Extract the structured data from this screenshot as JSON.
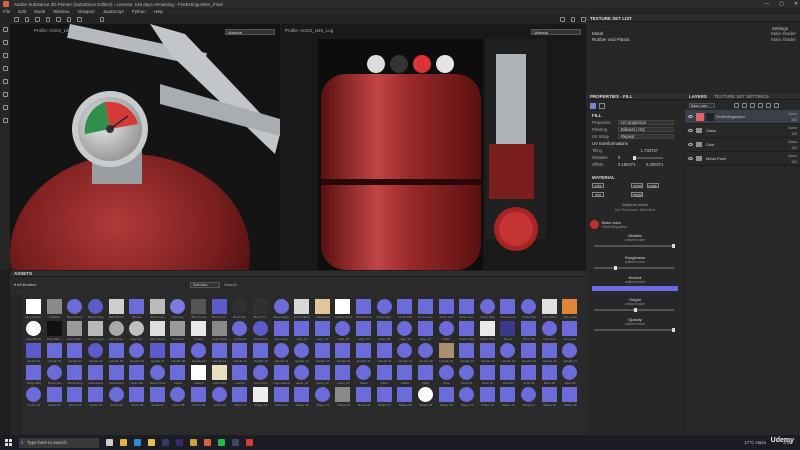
{
  "window": {
    "title": "Adobe Substance 3D Painter (Substance Edition) - License: 146 days remaining - FireExtinguisher_Final",
    "min": "—",
    "max": "▢",
    "close": "✕"
  },
  "menu": [
    "File",
    "Edit",
    "Mode",
    "Window",
    "Viewport",
    "JavaScript",
    "Python",
    "Help"
  ],
  "viewport3d": {
    "label": "Profile: ACES_LBS_Lug",
    "mode": "Material"
  },
  "viewport2d": {
    "label": "Profile: ACES_LBS_Lug",
    "mode": "Material"
  },
  "texture_set_list": {
    "title": "TEXTURE SET LIST",
    "settings": "Settings",
    "items": [
      {
        "name": "Metal",
        "shader": "Main shader"
      },
      {
        "name": "Rubber and Plastic",
        "shader": "Main shader"
      }
    ]
  },
  "properties": {
    "title": "PROPERTIES - FILL",
    "section_fill": "FILL",
    "projection_label": "Projection",
    "projection": "UV projection",
    "filtering_label": "Filtering",
    "filtering": "Bilinear | HQ",
    "uv_wrap_label": "UV Wrap",
    "uv_wrap": "Repeat",
    "uv_transform": "UV transformations",
    "tiling_label": "Tiling",
    "tiling_value": "1.733747",
    "rotation_label": "Rotation",
    "rotation_value": "0",
    "offset_label": "Offset",
    "offset_x": "0.180371",
    "offset_y": "0.260371",
    "material_section": "MATERIAL",
    "channels": [
      "color",
      "metal",
      "rough",
      "nrm",
      "height"
    ],
    "material_mode": "Material mode",
    "no_resource": "No Resource Selected",
    "base_color": "Base color",
    "base_color_sub": "FireExtinguisher",
    "metallic": "Metallic",
    "uniform": "uniform color",
    "roughness": "Roughness",
    "normal": "Normal",
    "height": "Height",
    "opacity": "Opacity"
  },
  "layers": {
    "tab1": "LAYERS",
    "tab2": "TEXTURE SET SETTINGS",
    "blend": "Base color",
    "items": [
      {
        "name": "FireExtinguisher",
        "blend": "Norm",
        "opacity": "100"
      },
      {
        "name": "Glass",
        "blend": "Norm",
        "opacity": "100"
      },
      {
        "name": "Dust",
        "blend": "Norm",
        "opacity": "100"
      },
      {
        "name": "Metal Paint",
        "blend": "Norm",
        "opacity": "100"
      }
    ]
  },
  "assets": {
    "title": "ASSETS",
    "all_libraries": "All libraries",
    "filter": "Selection",
    "search_placeholder": "Search",
    "tiles": [
      {
        "label": "Alloy Comm..",
        "color": "#ffffff"
      },
      {
        "label": "Artifacts",
        "color": "#8a8a8a"
      },
      {
        "label": "Bevel Rect..",
        "color": "#6b6bd9"
      },
      {
        "label": "Bevel Cape",
        "color": "#5c5cc8"
      },
      {
        "label": "Blob Brush",
        "color": "#cfcfcf"
      },
      {
        "label": "Bnoise",
        "color": "#6b6bd9"
      },
      {
        "label": "Bolt Cross",
        "color": "#bbbbbb"
      },
      {
        "label": "Bolt Hex",
        "color": "#7a7ae0"
      },
      {
        "label": "Brush Line",
        "color": "#555555"
      },
      {
        "label": "Bevel Circ..",
        "color": "#5c5cc8"
      },
      {
        "label": "Bevel Sq..",
        "color": "#303030"
      },
      {
        "label": "Bevel Tri..",
        "color": "#303030"
      },
      {
        "label": "Bevel Edge",
        "color": "#6b6bd9"
      },
      {
        "label": "Cloth Fabric",
        "color": "#d8d8d8"
      },
      {
        "label": "Cardboard",
        "color": "#e0c69a"
      },
      {
        "label": "Carbon Dust",
        "color": "#ffffff"
      },
      {
        "label": "Circle Bump",
        "color": "#6b6bd9"
      },
      {
        "label": "Circle Dam..",
        "color": "#6b6bd9"
      },
      {
        "label": "Circle Bolt",
        "color": "#6b6bd9"
      },
      {
        "label": "Circle Cent..",
        "color": "#6b6bd9"
      },
      {
        "label": "Circle Grid",
        "color": "#6b6bd9"
      },
      {
        "label": "Circle Hex..",
        "color": "#6b6bd9"
      },
      {
        "label": "Circle Hole",
        "color": "#6b6bd9"
      },
      {
        "label": "Circle Lines",
        "color": "#6b6bd9"
      },
      {
        "label": "Circle Pad",
        "color": "#6b6bd9"
      },
      {
        "label": "Clay Blend",
        "color": "#e0e0e0"
      },
      {
        "label": "Clay Grain",
        "color": "#e0853a"
      },
      {
        "label": "Clay Brush",
        "color": "#ffffff"
      },
      {
        "label": "Clay Blen..",
        "color": "#111111"
      },
      {
        "label": "Clay Stam..",
        "color": "#9a9a9a"
      },
      {
        "label": "Clay Rough",
        "color": "#b8b8b8"
      },
      {
        "label": "Clay Scrat..",
        "color": "#a8a8a8"
      },
      {
        "label": "Clay Spl..",
        "color": "#c0c0c0"
      },
      {
        "label": "Clay Stroke",
        "color": "#dedede"
      },
      {
        "label": "Concrete",
        "color": "#9a9a9a"
      },
      {
        "label": "Craters",
        "color": "#e8e8e8"
      },
      {
        "label": "Cube Mask",
        "color": "#8a8a8a"
      },
      {
        "label": "Cyl Bevel",
        "color": "#6b6bd9"
      },
      {
        "label": "Dirt Brush",
        "color": "#5c5cc8"
      },
      {
        "label": "Dot Large",
        "color": "#6b6bd9"
      },
      {
        "label": "edge_01",
        "color": "#6b6bd9"
      },
      {
        "label": "edge_02",
        "color": "#6b6bd9"
      },
      {
        "label": "edge_03",
        "color": "#6b6bd9"
      },
      {
        "label": "edge_04",
        "color": "#6b6bd9"
      },
      {
        "label": "edge_05",
        "color": "#6b6bd9"
      },
      {
        "label": "edge_06",
        "color": "#6b6bd9"
      },
      {
        "label": "edge_07",
        "color": "#6b6bd9"
      },
      {
        "label": "Fabric",
        "color": "#6b6bd9"
      },
      {
        "label": "Fabric Blue",
        "color": "#6b6bd9"
      },
      {
        "label": "Fabric Soft",
        "color": "#eaeaea"
      },
      {
        "label": "Fleece",
        "color": "#3a3a8a"
      },
      {
        "label": "Floor Tile",
        "color": "#6b6bd9"
      },
      {
        "label": "Fine Grid",
        "color": "#6b6bd9"
      },
      {
        "label": "Fine Dots",
        "color": "#6b6bd9"
      },
      {
        "label": "Handle 01",
        "color": "#5c5cc8"
      },
      {
        "label": "Handle 02",
        "color": "#6b6bd9"
      },
      {
        "label": "Handle 03",
        "color": "#6b6bd9"
      },
      {
        "label": "Handle 04",
        "color": "#5c5cc8"
      },
      {
        "label": "Handle 05",
        "color": "#6b6bd9"
      },
      {
        "label": "Handle 06",
        "color": "#6b6bd9"
      },
      {
        "label": "Handle 07",
        "color": "#5c5cc8"
      },
      {
        "label": "Handle 08",
        "color": "#6b6bd9"
      },
      {
        "label": "Handle 09",
        "color": "#6b6bd9"
      },
      {
        "label": "Handle 10",
        "color": "#6b6bd9"
      },
      {
        "label": "Handle 11",
        "color": "#6b6bd9"
      },
      {
        "label": "Handle 12",
        "color": "#6b6bd9"
      },
      {
        "label": "Handle 13",
        "color": "#6b6bd9"
      },
      {
        "label": "Handle 14",
        "color": "#6b6bd9"
      },
      {
        "label": "Handle 15",
        "color": "#6b6bd9"
      },
      {
        "label": "Handle 16",
        "color": "#6b6bd9"
      },
      {
        "label": "Handle 17",
        "color": "#6b6bd9"
      },
      {
        "label": "Handle 18",
        "color": "#6b6bd9"
      },
      {
        "label": "Handle 19",
        "color": "#6b6bd9"
      },
      {
        "label": "Handle 20",
        "color": "#6b6bd9"
      },
      {
        "label": "Handle 21",
        "color": "#a89070"
      },
      {
        "label": "Handle 22",
        "color": "#6b6bd9"
      },
      {
        "label": "Handle 23",
        "color": "#6b6bd9"
      },
      {
        "label": "Handle 24",
        "color": "#6b6bd9"
      },
      {
        "label": "Handle 25",
        "color": "#6b6bd9"
      },
      {
        "label": "Handle 26",
        "color": "#6b6bd9"
      },
      {
        "label": "Handle 27",
        "color": "#6b6bd9"
      },
      {
        "label": "Hinge Bolt",
        "color": "#6b6bd9"
      },
      {
        "label": "Hinge Nut",
        "color": "#6b6bd9"
      },
      {
        "label": "Hinge Ring",
        "color": "#6b6bd9"
      },
      {
        "label": "Hole Bevel",
        "color": "#6b6bd9"
      },
      {
        "label": "Hole Deep",
        "color": "#6b6bd9"
      },
      {
        "label": "Hole Flat",
        "color": "#6b6bd9"
      },
      {
        "label": "Honey Dots",
        "color": "#6b6bd9"
      },
      {
        "label": "Insets",
        "color": "#6b6bd9"
      },
      {
        "label": "Label 1",
        "color": "#ffffff"
      },
      {
        "label": "Label Text",
        "color": "#e8e0c0"
      },
      {
        "label": "Leather",
        "color": "#6b6bd9"
      },
      {
        "label": "Logo Rect",
        "color": "#6b6bd9"
      },
      {
        "label": "Logo Round",
        "color": "#6b6bd9"
      },
      {
        "label": "panel_01",
        "color": "#6b6bd9"
      },
      {
        "label": "panel_02",
        "color": "#6b6bd9"
      },
      {
        "label": "panel_03",
        "color": "#6b6bd9"
      },
      {
        "label": "Paper",
        "color": "#6b6bd9"
      },
      {
        "label": "Patch",
        "color": "#6b6bd9"
      },
      {
        "label": "Plastic",
        "color": "#6b6bd9"
      },
      {
        "label": "Plate",
        "color": "#6b6bd9"
      },
      {
        "label": "Pipe",
        "color": "#6b6bd9"
      },
      {
        "label": "Rivet 01",
        "color": "#6b6bd9"
      },
      {
        "label": "Rivet 02",
        "color": "#6b6bd9"
      },
      {
        "label": "Rivet 03",
        "color": "#6b6bd9"
      },
      {
        "label": "Rivet 04",
        "color": "#6b6bd9"
      },
      {
        "label": "Rivet 05",
        "color": "#6b6bd9"
      },
      {
        "label": "Rivet 06",
        "color": "#6b6bd9"
      },
      {
        "label": "Screw 01",
        "color": "#6b6bd9"
      },
      {
        "label": "Screw 02",
        "color": "#6b6bd9"
      },
      {
        "label": "Screw 03",
        "color": "#6b6bd9"
      },
      {
        "label": "Screw 04",
        "color": "#6b6bd9"
      },
      {
        "label": "Screw 05",
        "color": "#6b6bd9"
      },
      {
        "label": "Screw 06",
        "color": "#6b6bd9"
      },
      {
        "label": "Screw 07",
        "color": "#6b6bd9"
      },
      {
        "label": "Screw 08",
        "color": "#6b6bd9"
      },
      {
        "label": "Screw 09",
        "color": "#6b6bd9"
      },
      {
        "label": "Screw 10",
        "color": "#6b6bd9"
      },
      {
        "label": "Screw 11",
        "color": "#6b6bd9"
      },
      {
        "label": "Shape 01",
        "color": "#eeeeee"
      },
      {
        "label": "Shape 02",
        "color": "#6b6bd9"
      },
      {
        "label": "Shape 03",
        "color": "#6b6bd9"
      },
      {
        "label": "Shape 04",
        "color": "#6b6bd9"
      },
      {
        "label": "Shape 05",
        "color": "#8a8a8a"
      },
      {
        "label": "Shape 06",
        "color": "#6b6bd9"
      },
      {
        "label": "Shape 07",
        "color": "#6b6bd9"
      },
      {
        "label": "Shape 08",
        "color": "#6b6bd9"
      },
      {
        "label": "Shape 09",
        "color": "#ffffff"
      },
      {
        "label": "Shape 10",
        "color": "#6b6bd9"
      },
      {
        "label": "Shape 11",
        "color": "#6b6bd9"
      },
      {
        "label": "Shape 12",
        "color": "#6b6bd9"
      },
      {
        "label": "Shape 13",
        "color": "#6b6bd9"
      },
      {
        "label": "Shape 14",
        "color": "#6b6bd9"
      },
      {
        "label": "Shape 15",
        "color": "#6b6bd9"
      },
      {
        "label": "Shape 16",
        "color": "#6b6bd9"
      }
    ]
  },
  "taskbar": {
    "search_placeholder": "Type here to search",
    "weather": "17°C Haze",
    "time": "4:01",
    "apps": [
      {
        "name": "task-view-icon",
        "color": "#cfcfcf"
      },
      {
        "name": "chrome-icon",
        "color": "#e8b23a"
      },
      {
        "name": "edge-icon",
        "color": "#2f8ad9"
      },
      {
        "name": "explorer-icon",
        "color": "#e9c04a"
      },
      {
        "name": "photoshop-icon",
        "color": "#2d3e63"
      },
      {
        "name": "premiere-icon",
        "color": "#3b2a6b"
      },
      {
        "name": "substance-designer-icon",
        "color": "#c8a23a"
      },
      {
        "name": "substance-painter-icon",
        "color": "#d9623b"
      },
      {
        "name": "spotify-icon",
        "color": "#1db954"
      },
      {
        "name": "steam-icon",
        "color": "#3c4a5a"
      },
      {
        "name": "record-icon",
        "color": "#d63a3a"
      }
    ]
  },
  "watermark": "Udemy"
}
